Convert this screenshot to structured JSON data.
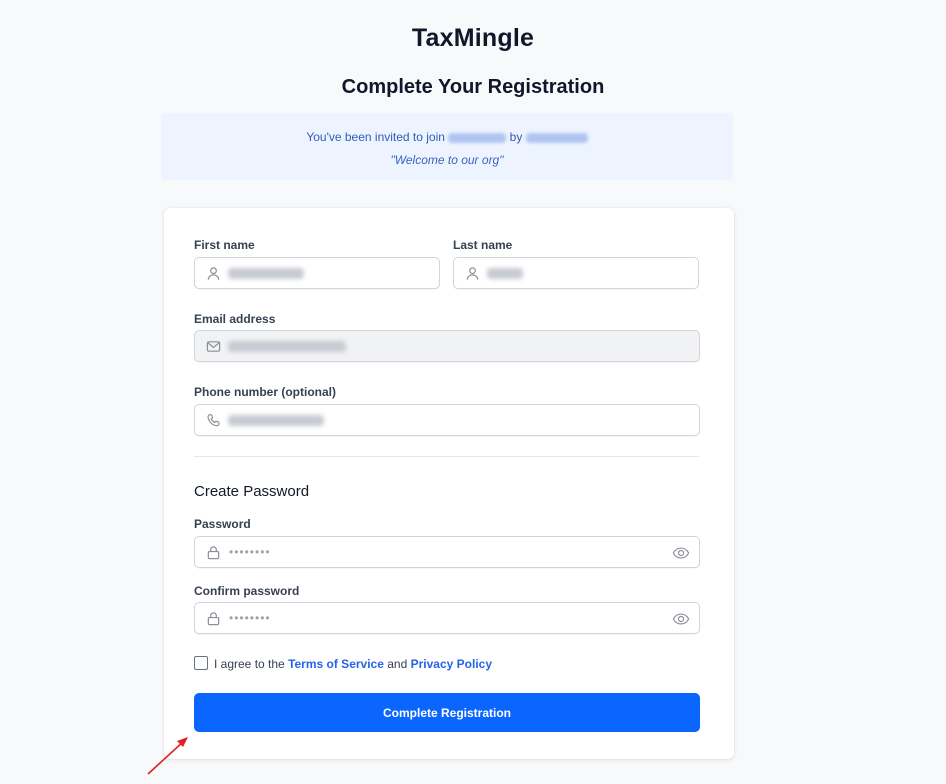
{
  "app": {
    "title": "TaxMingle"
  },
  "page": {
    "heading": "Complete Your Registration"
  },
  "invite": {
    "prefix": "You've been invited to join",
    "by": "by",
    "message": "\"Welcome to our org\""
  },
  "form": {
    "first_name": {
      "label": "First name"
    },
    "last_name": {
      "label": "Last name"
    },
    "email": {
      "label": "Email address"
    },
    "phone": {
      "label": "Phone number (optional)"
    },
    "password_section_title": "Create Password",
    "password": {
      "label": "Password",
      "value": "••••••••"
    },
    "confirm_password": {
      "label": "Confirm password",
      "value": "••••••••"
    },
    "agree": {
      "prefix": "I agree to the",
      "terms_link": "Terms of Service",
      "and": "and",
      "privacy_link": "Privacy Policy"
    },
    "submit_label": "Complete Registration"
  },
  "colors": {
    "primary": "#0a66ff",
    "link": "#2563eb",
    "invite_bg": "#eef4ff",
    "annotation_arrow": "#e02020"
  }
}
